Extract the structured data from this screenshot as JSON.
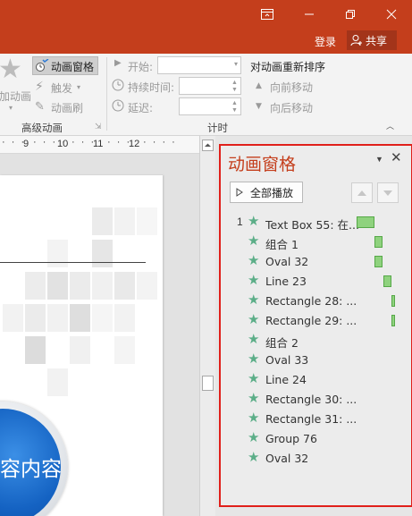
{
  "window": {
    "icons": [
      "ribbon-display-icon",
      "minimize-icon",
      "restore-icon",
      "close-icon"
    ]
  },
  "account": {
    "login_label": "登录",
    "share_label": "共享"
  },
  "ribbon": {
    "animation_pane_label": "动画窗格",
    "add_animation_label": "加动画",
    "trigger_label": "触发",
    "animation_painter_label": "动画刷",
    "advanced_group_label": "高级动画",
    "start_label": "开始:",
    "start_value": "",
    "duration_label": "持续时间:",
    "duration_value": "",
    "delay_label": "延迟:",
    "delay_value": "",
    "timing_group_label": "计时",
    "reorder_label": "对动画重新排序",
    "move_earlier_label": "向前移动",
    "move_later_label": "向后移动"
  },
  "ruler": {
    "ticks": [
      "9",
      "10",
      "11",
      "12"
    ]
  },
  "slide": {
    "circle_text": "容内容"
  },
  "pane": {
    "title": "动画窗格",
    "play_all_label": "全部播放",
    "items": [
      {
        "num": "1",
        "label": "Text Box 55: 在..."
      },
      {
        "num": "",
        "label": "组合 1"
      },
      {
        "num": "",
        "label": "Oval 32"
      },
      {
        "num": "",
        "label": "Line 23"
      },
      {
        "num": "",
        "label": "Rectangle 28: ..."
      },
      {
        "num": "",
        "label": "Rectangle 29: ..."
      },
      {
        "num": "",
        "label": "组合 2"
      },
      {
        "num": "",
        "label": "Oval 33"
      },
      {
        "num": "",
        "label": "Line 24"
      },
      {
        "num": "",
        "label": "Rectangle 30: ..."
      },
      {
        "num": "",
        "label": "Rectangle 31: ..."
      },
      {
        "num": "",
        "label": "Group 76"
      },
      {
        "num": "",
        "label": "Oval 32"
      }
    ]
  },
  "colors": {
    "title_bar": "#c43e1c",
    "pane_border": "#e0201b",
    "timeline_bar": "#8fd27e",
    "star": "#5cae88"
  }
}
